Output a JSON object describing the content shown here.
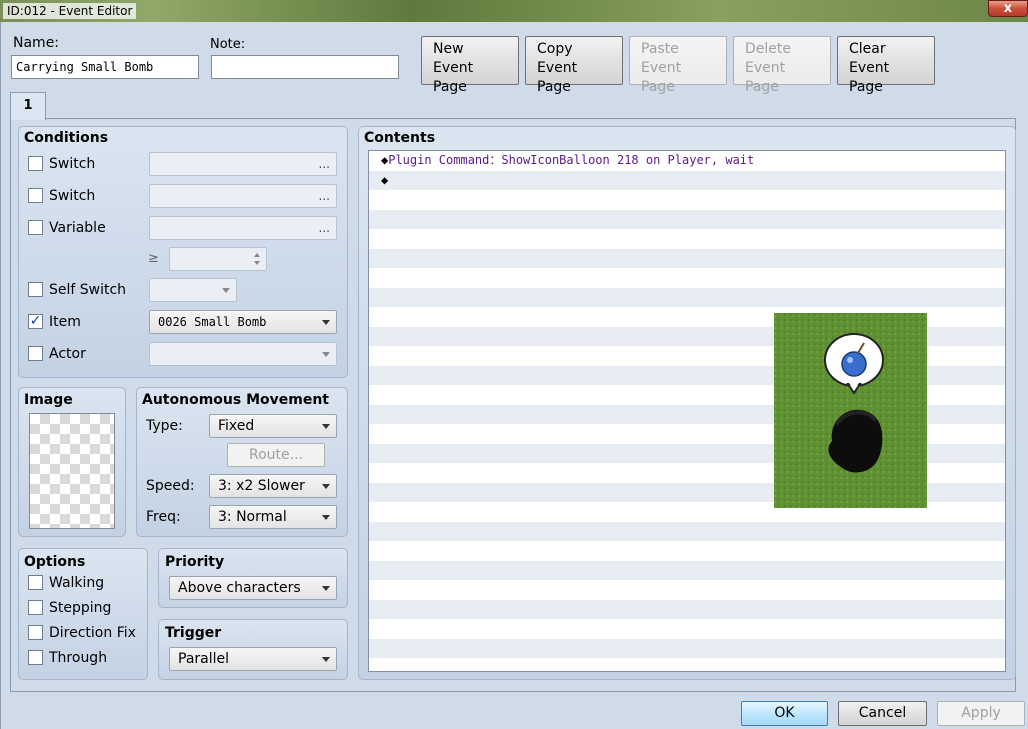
{
  "window": {
    "title": "ID:012 - Event Editor",
    "close_glyph": "x"
  },
  "header": {
    "name_label": "Name:",
    "name_value": "Carrying Small Bomb",
    "note_label": "Note:",
    "note_value": ""
  },
  "toolbar": {
    "new_line1": "New",
    "new_line2": "Event Page",
    "copy_line1": "Copy",
    "copy_line2": "Event Page",
    "paste_line1": "Paste",
    "paste_line2": "Event Page",
    "delete_line1": "Delete",
    "delete_line2": "Event Page",
    "clear_line1": "Clear",
    "clear_line2": "Event Page"
  },
  "tabs": [
    "1"
  ],
  "conditions": {
    "title": "Conditions",
    "switch1": {
      "label": "Switch",
      "checked": false,
      "value": "",
      "ellipsis": "..."
    },
    "switch2": {
      "label": "Switch",
      "checked": false,
      "value": "",
      "ellipsis": "..."
    },
    "variable": {
      "label": "Variable",
      "checked": false,
      "value": "",
      "ellipsis": "...",
      "compare": "≥",
      "number": ""
    },
    "self_switch": {
      "label": "Self Switch",
      "checked": false,
      "value": ""
    },
    "item": {
      "label": "Item",
      "checked": true,
      "check_glyph": "✓",
      "value": "0026 Small Bomb"
    },
    "actor": {
      "label": "Actor",
      "checked": false,
      "value": ""
    }
  },
  "image": {
    "title": "Image"
  },
  "autonomous": {
    "title": "Autonomous Movement",
    "type_label": "Type:",
    "type_value": "Fixed",
    "route_label": "Route...",
    "speed_label": "Speed:",
    "speed_value": "3: x2 Slower",
    "freq_label": "Freq:",
    "freq_value": "3: Normal"
  },
  "options": {
    "title": "Options",
    "items": [
      "Walking",
      "Stepping",
      "Direction Fix",
      "Through"
    ]
  },
  "priority": {
    "title": "Priority",
    "value": "Above characters"
  },
  "trigger": {
    "title": "Trigger",
    "value": "Parallel"
  },
  "contents": {
    "title": "Contents",
    "bullet": "◆",
    "commands": [
      "Plugin Command：ShowIconBalloon 218 on Player, wait",
      ""
    ]
  },
  "buttons": {
    "ok": "OK",
    "cancel": "Cancel",
    "apply": "Apply"
  },
  "colors": {
    "window_bg": "#cfdbe9",
    "command_text": "#5b1a8a",
    "grass": "#5a8a2c"
  }
}
